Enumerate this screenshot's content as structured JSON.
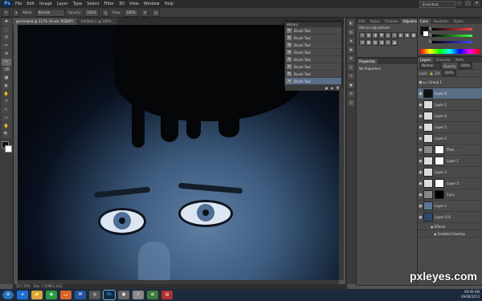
{
  "app": {
    "logo": "Ps",
    "menu": [
      "File",
      "Edit",
      "Image",
      "Layer",
      "Type",
      "Select",
      "Filter",
      "3D",
      "View",
      "Window",
      "Help"
    ],
    "workspace": "Essentials",
    "window_controls": [
      "–",
      "□",
      "✕"
    ]
  },
  "options_bar": {
    "mode_label": "Mode:",
    "mode_value": "Normal",
    "opacity_label": "Opacity:",
    "opacity_value": "100%",
    "flow_label": "Flow:",
    "flow_value": "100%"
  },
  "tools": [
    "✥",
    "⬚",
    "ʘ",
    "✂",
    "⊕",
    "✎",
    "⌫",
    "▩",
    "◐",
    "✋",
    "T",
    "↖",
    "▭",
    "✋",
    "🔍"
  ],
  "document_tabs": [
    {
      "label": "gorchepad @ 317% (Gruts, RGB/8*)",
      "active": true
    },
    {
      "label": "Untitled-1 @ 100%...",
      "active": false
    }
  ],
  "status_bar": {
    "zoom": "317.70%",
    "doc": "Doc: 7.03M/1.41G"
  },
  "history_panel": {
    "title": "History",
    "items": [
      "Brush Tool",
      "Brush Tool",
      "Brush Tool",
      "Brush Tool",
      "Brush Tool",
      "Brush Tool",
      "Brush Tool",
      "Brush Tool"
    ]
  },
  "right_dock_icons": [
    "◧",
    "▤",
    "◈",
    "▦",
    "⚙",
    "◎",
    "✎",
    "▣",
    "☰",
    "◫"
  ],
  "adjustments_panel": {
    "tabs": [
      "Info",
      "Styles",
      "Timeline",
      "Adjustments"
    ],
    "active_tab": "Adjustments",
    "title": "Add an adjustment",
    "icons": [
      "☼",
      "▥",
      "◑",
      "▼",
      "◭",
      "⚖",
      "◐",
      "◉",
      "▦",
      "⊞",
      "▩",
      "▨",
      "◨",
      "⊟",
      "◪"
    ]
  },
  "properties_panel": {
    "tabs": [
      "Properties"
    ],
    "content": "No Properties"
  },
  "color_panel": {
    "tabs": [
      "Color",
      "Swatches",
      "Styles"
    ],
    "sliders": [
      {
        "label": "R",
        "color": "#ff4444"
      },
      {
        "label": "G",
        "color": "#44ff44"
      },
      {
        "label": "B",
        "color": "#4444ff"
      }
    ],
    "foreground": "#111111",
    "background": "#ffffff"
  },
  "layers_panel": {
    "tabs": [
      "Layers",
      "Channels",
      "Paths"
    ],
    "blend_mode": "Normal",
    "opacity_label": "Opacity:",
    "opacity_value": "100%",
    "lock_label": "Lock:",
    "fill_label": "Fill:",
    "fill_value": "100%",
    "layers": [
      {
        "name": "Group 1",
        "type": "group"
      },
      {
        "name": "Layer 8",
        "type": "layer",
        "selected": true,
        "thumb": "dark"
      },
      {
        "name": "Layer 2",
        "type": "layer"
      },
      {
        "name": "Layer 6",
        "type": "layer"
      },
      {
        "name": "Layer 5",
        "type": "layer"
      },
      {
        "name": "Layer 4",
        "type": "layer"
      },
      {
        "name": "Phot...",
        "type": "adjust"
      },
      {
        "name": "Layer 1",
        "type": "layer"
      },
      {
        "name": "Layer 3",
        "type": "layer"
      },
      {
        "name": "Layer 2",
        "type": "layer"
      },
      {
        "name": "Curv...",
        "type": "adjust"
      },
      {
        "name": "Layer 1",
        "type": "layer",
        "thumb": "face"
      },
      {
        "name": "Layer 0",
        "type": "layer",
        "thumb": "face"
      },
      {
        "name": "Effects",
        "type": "effect"
      },
      {
        "name": "Gradient Overlay",
        "type": "effect"
      }
    ]
  },
  "taskbar": {
    "items": [
      {
        "label": "⊞",
        "color": "#2a6fb8"
      },
      {
        "label": "e",
        "color": "#1f6fd0"
      },
      {
        "label": "📁",
        "color": "#d9a53a"
      },
      {
        "label": "◉",
        "color": "#2b9a3e"
      },
      {
        "label": "🦊",
        "color": "#d8632a"
      },
      {
        "label": "W",
        "color": "#2255a0"
      },
      {
        "label": "◎",
        "color": "#555555"
      },
      {
        "label": "Ps",
        "color": "#0d2b4a",
        "active": true
      },
      {
        "label": "▣",
        "color": "#666666"
      },
      {
        "label": "♪",
        "color": "#8a8a8a"
      },
      {
        "label": "◍",
        "color": "#3b7a3b"
      },
      {
        "label": "▤",
        "color": "#b03030"
      }
    ],
    "time": "09:00 AM",
    "date": "09/08/2013"
  },
  "watermark": "pxleyes.com"
}
